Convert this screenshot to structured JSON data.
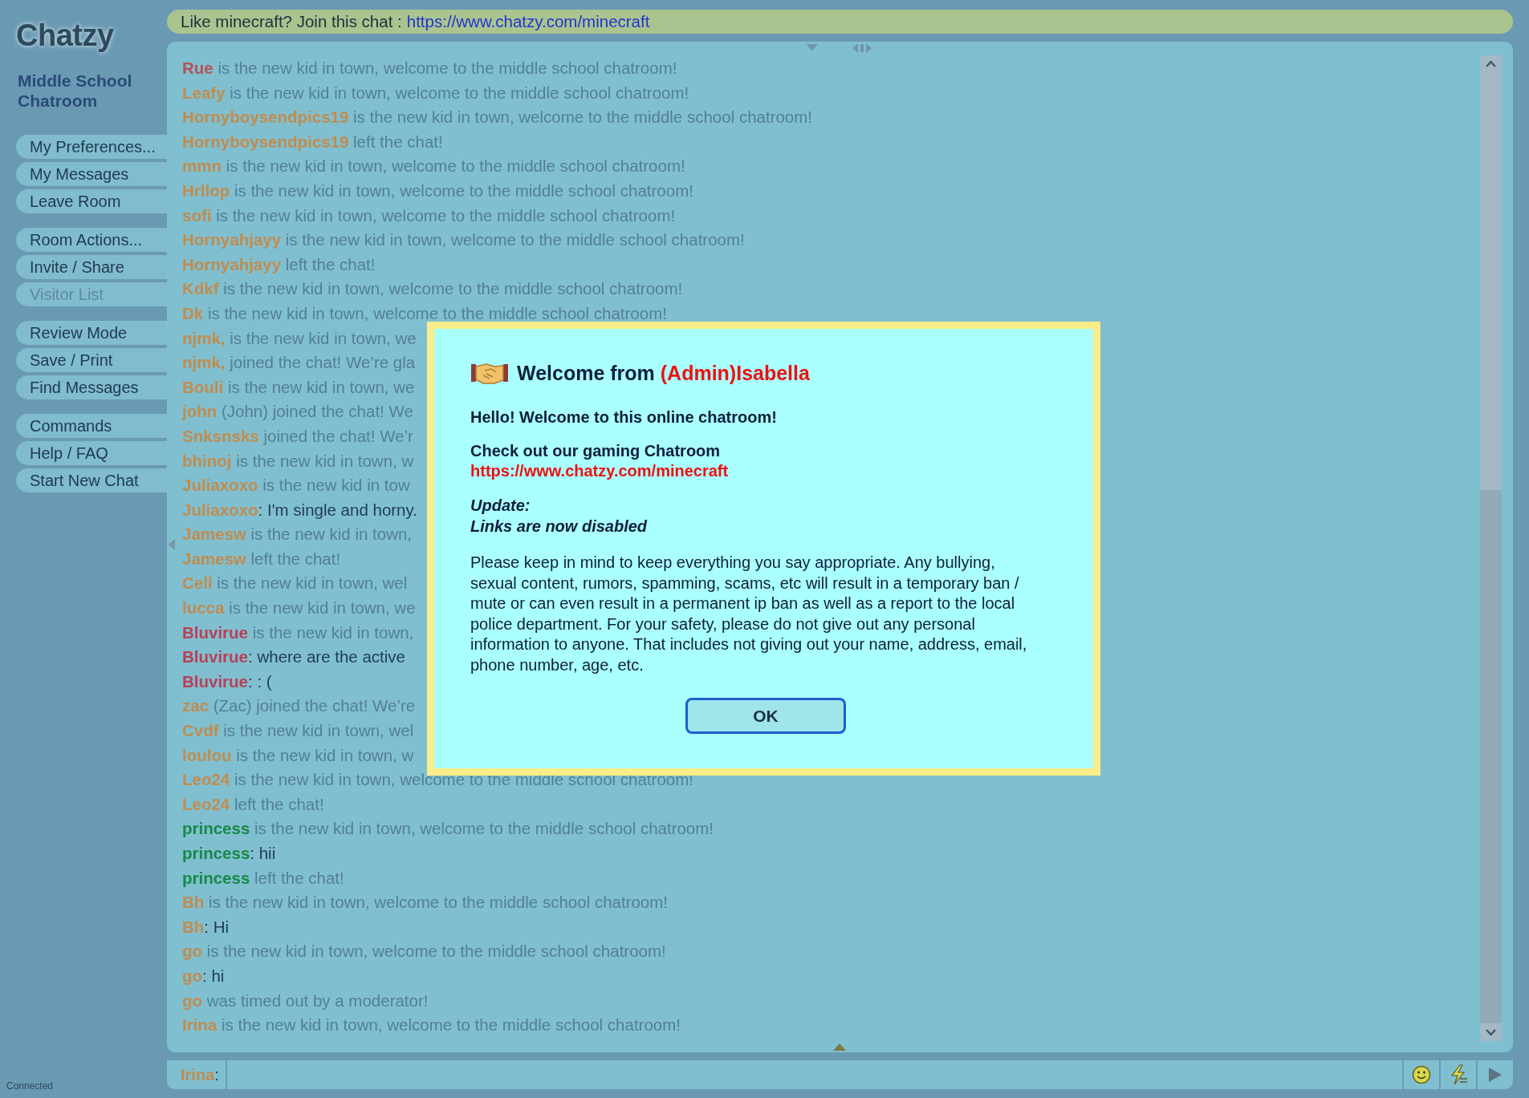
{
  "sidebar": {
    "logo": "Chatzy",
    "room_title": "Middle School Chatroom",
    "menu_groups": [
      [
        {
          "label": "My Preferences...",
          "disabled": false
        },
        {
          "label": "My Messages",
          "disabled": false
        },
        {
          "label": "Leave Room",
          "disabled": false
        }
      ],
      [
        {
          "label": "Room Actions...",
          "disabled": false
        },
        {
          "label": "Invite / Share",
          "disabled": false
        },
        {
          "label": "Visitor List",
          "disabled": true
        }
      ],
      [
        {
          "label": "Review Mode",
          "disabled": false
        },
        {
          "label": "Save / Print",
          "disabled": false
        },
        {
          "label": "Find Messages",
          "disabled": false
        }
      ],
      [
        {
          "label": "Commands",
          "disabled": false
        },
        {
          "label": "Help / FAQ",
          "disabled": false
        },
        {
          "label": "Start New Chat",
          "disabled": false
        }
      ]
    ],
    "status": "Connected"
  },
  "banner": {
    "text": "Like minecraft? Join this chat :",
    "link": "https://www.chatzy.com/minecraft"
  },
  "messages": [
    {
      "name": "Rue",
      "color": "#b8505a",
      "kind": "event",
      "text": "is the new kid in town, welcome to the middle school chatroom!"
    },
    {
      "name": "Leafy",
      "color": "#c08c50",
      "kind": "event",
      "text": "is the new kid in town, welcome to the middle school chatroom!"
    },
    {
      "name": "Hornyboysendpics19",
      "color": "#c08c50",
      "kind": "event",
      "text": "is the new kid in town, welcome to the middle school chatroom!"
    },
    {
      "name": "Hornyboysendpics19",
      "color": "#c08c50",
      "kind": "event",
      "text": "left the chat!"
    },
    {
      "name": "mmn",
      "color": "#c08c50",
      "kind": "event",
      "text": "is the new kid in town, welcome to the middle school chatroom!"
    },
    {
      "name": "Hrllop",
      "color": "#c08c50",
      "kind": "event",
      "text": "is the new kid in town, welcome to the middle school chatroom!"
    },
    {
      "name": "sofi",
      "color": "#c08c50",
      "kind": "event",
      "text": "is the new kid in town, welcome to the middle school chatroom!"
    },
    {
      "name": "Hornyahjayy",
      "color": "#c08c50",
      "kind": "event",
      "text": "is the new kid in town, welcome to the middle school chatroom!"
    },
    {
      "name": "Hornyahjayy",
      "color": "#c08c50",
      "kind": "event",
      "text": "left the chat!"
    },
    {
      "name": "Kdkf",
      "color": "#c08c50",
      "kind": "event",
      "text": "is the new kid in town, welcome to the middle school chatroom!"
    },
    {
      "name": "Dk",
      "color": "#c08c50",
      "kind": "event",
      "text": "is the new kid in town, welcome to the middle school chatroom!"
    },
    {
      "name": "njmk,",
      "color": "#c08c50",
      "kind": "event",
      "text": "is the new kid in town, we"
    },
    {
      "name": "njmk,",
      "color": "#c08c50",
      "kind": "event",
      "text": "joined the chat! We’re gla"
    },
    {
      "name": "Bouli",
      "color": "#c08c50",
      "kind": "event",
      "text": "is the new kid in town, we"
    },
    {
      "name": "john",
      "color": "#c08c50",
      "kind": "event",
      "text": "(John) joined the chat! We"
    },
    {
      "name": "Snksnsks",
      "color": "#c08c50",
      "kind": "event",
      "text": "joined the chat! We’r"
    },
    {
      "name": "bhinoj",
      "color": "#c08c50",
      "kind": "event",
      "text": "is the new kid in town, w"
    },
    {
      "name": "Juliaxoxo",
      "color": "#c08c50",
      "kind": "event",
      "text": "is the new kid in tow"
    },
    {
      "name": "Juliaxoxo",
      "color": "#c08c50",
      "kind": "chat",
      "text": ": I'm single and horny."
    },
    {
      "name": "Jamesw",
      "color": "#c08c50",
      "kind": "event",
      "text": "is the new kid in town,"
    },
    {
      "name": "Jamesw",
      "color": "#c08c50",
      "kind": "event",
      "text": "left the chat!"
    },
    {
      "name": "Cell",
      "color": "#c08c50",
      "kind": "event",
      "text": "is the new kid in town, wel"
    },
    {
      "name": "lucca",
      "color": "#c08c50",
      "kind": "event",
      "text": "is the new kid in town, we"
    },
    {
      "name": "Bluvirue",
      "color": "#b8405a",
      "kind": "event",
      "text": "is the new kid in town,"
    },
    {
      "name": "Bluvirue",
      "color": "#b8405a",
      "kind": "chat",
      "text": ": where are the active"
    },
    {
      "name": "Bluvirue",
      "color": "#b8405a",
      "kind": "chat",
      "text": ": : ("
    },
    {
      "name": "zac",
      "color": "#c08c50",
      "kind": "event",
      "text": "(Zac) joined the chat! We’re"
    },
    {
      "name": "Cvdf",
      "color": "#c08c50",
      "kind": "event",
      "text": "is the new kid in town, wel"
    },
    {
      "name": "loulou",
      "color": "#c08c50",
      "kind": "event",
      "text": "is the new kid in town, w"
    },
    {
      "name": "Leo24",
      "color": "#c08c50",
      "kind": "event",
      "text": "is the new kid in town, welcome to the middle school chatroom!"
    },
    {
      "name": "Leo24",
      "color": "#c08c50",
      "kind": "event",
      "text": "left the chat!"
    },
    {
      "name": "princess",
      "color": "#17894a",
      "kind": "event",
      "text": "is the new kid in town, welcome to the middle school chatroom!"
    },
    {
      "name": "princess",
      "color": "#17894a",
      "kind": "chat",
      "text": ": hii"
    },
    {
      "name": "princess",
      "color": "#17894a",
      "kind": "event",
      "text": "left the chat!"
    },
    {
      "name": "Bh",
      "color": "#c08c50",
      "kind": "event",
      "text": "is the new kid in town, welcome to the middle school chatroom!"
    },
    {
      "name": "Bh",
      "color": "#c08c50",
      "kind": "chat",
      "text": ": Hi"
    },
    {
      "name": "go",
      "color": "#c08c50",
      "kind": "event",
      "text": "is the new kid in town, welcome to the middle school chatroom!"
    },
    {
      "name": "go",
      "color": "#c08c50",
      "kind": "chat",
      "text": ": hi"
    },
    {
      "name": "go",
      "color": "#c08c50",
      "kind": "event",
      "text": "was timed out by a moderator!"
    },
    {
      "name": "Irina",
      "color": "#c08c50",
      "kind": "event",
      "text": "is the new kid in town, welcome to the middle school chatroom!"
    }
  ],
  "input": {
    "name": "Irina",
    "separator": ":"
  },
  "dialog": {
    "title": "Welcome from",
    "sender": "(Admin)Isabella",
    "greeting": "Hello! Welcome to this online chatroom!",
    "promo": "Check out our gaming Chatroom",
    "promo_link": "https://www.chatzy.com/minecraft",
    "update_title": "Update:",
    "update_text": "Links are now disabled",
    "body": "Please keep in mind to keep everything you say appropriate. Any bullying, sexual content, rumors, spamming, scams, etc will result in a temporary ban / mute or can even result in a permanent ip ban as well as a report to the local police department. For your safety, please do not give out any personal information to anyone. That includes not giving out your name, address, email, phone number, age, etc.",
    "button": "OK"
  }
}
